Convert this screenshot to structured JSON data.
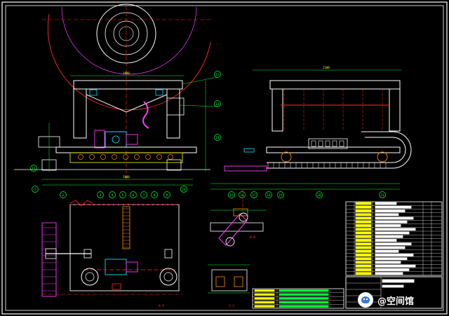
{
  "drawing": {
    "colors": {
      "frame": "#ffffff",
      "steel": "#ffffff",
      "cyan": "#00e5ff",
      "magenta": "#ff3bff",
      "yellow": "#ffff00",
      "green": "#00ff3c",
      "red": "#ff2a2a",
      "blue": "#3b5bff",
      "orange": "#ff8a00"
    },
    "section_labels": {
      "plan": "A-A",
      "side": "B-B",
      "detail": "C-C"
    },
    "callouts_front": [
      "1",
      "2",
      "3",
      "4",
      "5",
      "6",
      "7",
      "8",
      "9",
      "10",
      "11",
      "12",
      "13",
      "14"
    ],
    "callouts_side": [
      "15",
      "16",
      "17",
      "18",
      "19",
      "20",
      "21"
    ],
    "parts_rows": 20,
    "title_block_rows": 5
  },
  "watermark": {
    "text": "@空间馆",
    "icon": "chat-bubble-icon"
  }
}
